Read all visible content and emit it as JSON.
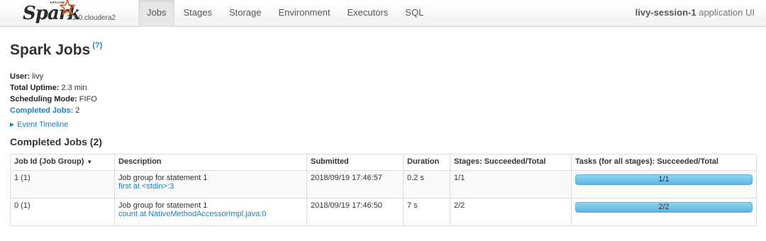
{
  "brand": {
    "apache_text": "APACHE",
    "spark_text": "Spark",
    "version": "2.2.0.cloudera2"
  },
  "nav": {
    "tabs": [
      {
        "label": "Jobs",
        "active": true
      },
      {
        "label": "Stages",
        "active": false
      },
      {
        "label": "Storage",
        "active": false
      },
      {
        "label": "Environment",
        "active": false
      },
      {
        "label": "Executors",
        "active": false
      },
      {
        "label": "SQL",
        "active": false
      }
    ],
    "app_name": "livy-session-1",
    "app_suffix": " application UI"
  },
  "page": {
    "title": "Spark Jobs",
    "help": "(?)"
  },
  "summary": {
    "user_label": "User:",
    "user_value": " livy",
    "uptime_label": "Total Uptime:",
    "uptime_value": " 2.3 min",
    "mode_label": "Scheduling Mode:",
    "mode_value": " FIFO",
    "completed_label": "Completed Jobs:",
    "completed_value": " 2"
  },
  "timeline": {
    "label": "Event Timeline",
    "icon": "triangle-right-icon"
  },
  "completed_section": {
    "title": "Completed Jobs (2)",
    "headers": {
      "job_id": "Job Id (Job Group)",
      "description": "Description",
      "submitted": "Submitted",
      "duration": "Duration",
      "stages": "Stages: Succeeded/Total",
      "tasks": "Tasks (for all stages): Succeeded/Total"
    },
    "rows": [
      {
        "job_id": "1 (1)",
        "desc": "Job group for statement 1",
        "link": "first at <stdin>:3",
        "submitted": "2018/09/19 17:46:57",
        "duration": "0.2 s",
        "stages": "1/1",
        "tasks": "1/1",
        "tasks_fraction": 1.0
      },
      {
        "job_id": "0 (1)",
        "desc": "Job group for statement 1",
        "link": "count at NativeMethodAccessorImpl.java:0",
        "submitted": "2018/09/19 17:46:50",
        "duration": "7 s",
        "stages": "2/2",
        "tasks": "2/2",
        "tasks_fraction": 1.0
      }
    ]
  },
  "colors": {
    "link": "#1a7fbe",
    "progress": "#5bb7e6",
    "star": "#e25a1c"
  }
}
